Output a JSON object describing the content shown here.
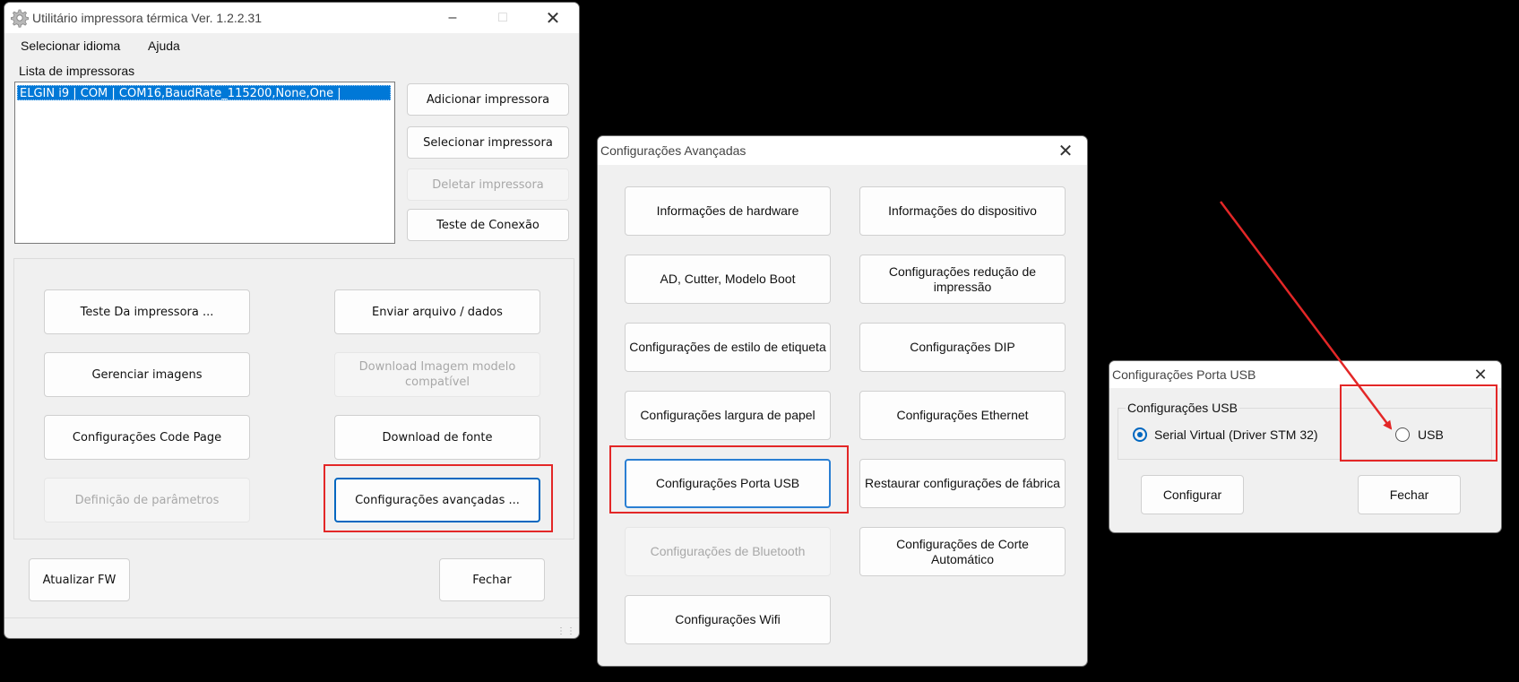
{
  "main_window": {
    "title": "Utilitário impressora térmica Ver. 1.2.2.31",
    "menu": [
      "Selecionar idioma",
      "Ajuda"
    ],
    "printer_list_label": "Lista de impressoras",
    "printers": [
      "ELGIN i9 | COM | COM16,BaudRate_115200,None,One |"
    ],
    "side_buttons": {
      "add": "Adicionar impressora",
      "select": "Selecionar impressora",
      "delete": "Deletar impressora",
      "test_connection": "Teste de Conexão"
    },
    "buttons": {
      "test_printer": "Teste Da impressora ...",
      "send_file": "Enviar arquivo / dados",
      "manage_images": "Gerenciar imagens",
      "download_image_model": "Download Imagem modelo compatível",
      "code_page": "Configurações Code Page",
      "download_font": "Download de fonte",
      "parameters": "Definição de parâmetros",
      "advanced": "Configurações avançadas ...",
      "update_fw": "Atualizar FW",
      "close": "Fechar"
    }
  },
  "advanced_window": {
    "title": "Configurações Avançadas",
    "buttons": {
      "hardware_info": "Informações de hardware",
      "device_info": "Informações do dispositivo",
      "ad_cutter": "AD, Cutter, Modelo Boot",
      "print_reduction": "Configurações redução de impressão",
      "label_style": "Configurações de estilo de etiqueta",
      "dip": "Configurações DIP",
      "paper_width": "Configurações largura de papel",
      "ethernet": "Configurações Ethernet",
      "usb_port": "Configurações Porta USB",
      "factory_reset": "Restaurar configurações de fábrica",
      "bluetooth": "Configurações de Bluetooth",
      "auto_cut": "Configurações de Corte  Automático",
      "wifi": "Configurações Wifi"
    }
  },
  "usb_window": {
    "title": "Configurações Porta USB",
    "group_label": "Configurações USB",
    "radio_serial": "Serial Virtual (Driver STM 32)",
    "radio_usb": "USB",
    "selected": "Serial Virtual (Driver STM 32)",
    "configure": "Configurar",
    "close": "Fechar"
  },
  "colors": {
    "highlight": "#e32727",
    "accent": "#0067c0",
    "selection": "#0078d7"
  }
}
